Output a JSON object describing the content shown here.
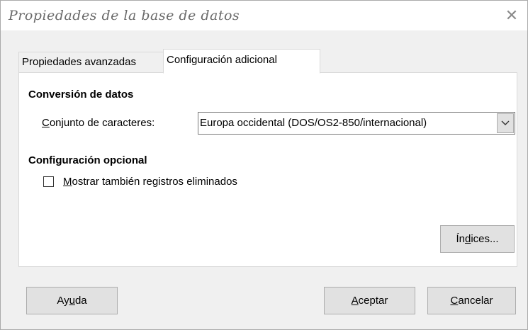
{
  "window": {
    "title": "Propiedades de la base de datos",
    "close_glyph": "✕"
  },
  "tabs": [
    {
      "label": "Propiedades avanzadas",
      "active": false
    },
    {
      "label": "Configuración adicional",
      "active": true
    }
  ],
  "conversion": {
    "heading": "Conversión de datos",
    "charset_label_mnemonic": "C",
    "charset_label_rest": "onjunto de caracteres:",
    "charset_value": "Europa occidental (DOS/OS2-850/internacional)"
  },
  "optional": {
    "heading": "Configuración opcional",
    "show_deleted_mnemonic": "M",
    "show_deleted_rest": "ostrar también registros eliminados",
    "show_deleted_checked": false
  },
  "buttons": {
    "indices_pre": "Ín",
    "indices_mnemonic": "d",
    "indices_post": "ices...",
    "help_pre": "Ay",
    "help_mnemonic": "u",
    "help_post": "da",
    "ok_mnemonic": "A",
    "ok_rest": "ceptar",
    "cancel_mnemonic": "C",
    "cancel_rest": "ancelar"
  },
  "icons": {
    "close": "close-icon",
    "dropdown": "chevron-down-icon"
  }
}
